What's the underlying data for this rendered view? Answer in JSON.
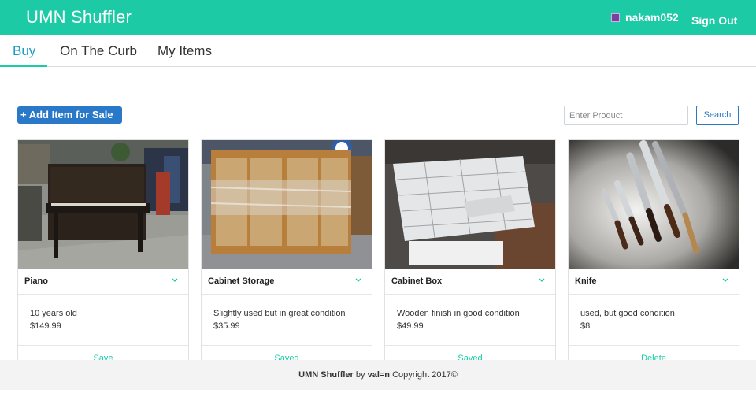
{
  "app": {
    "brand": "UMN Shuffler"
  },
  "header": {
    "username": "nakam052",
    "sign_out": "Sign Out"
  },
  "tabs": [
    {
      "label": "Buy",
      "active": true
    },
    {
      "label": "On The Curb",
      "active": false
    },
    {
      "label": "My Items",
      "active": false
    }
  ],
  "toolbar": {
    "add_label": "+ Add Item for Sale",
    "search_placeholder": "Enter Product",
    "search_value": "",
    "search_button": "Search"
  },
  "items": [
    {
      "title": "Piano",
      "description": "10 years old",
      "price": "$149.99",
      "action": "Save",
      "image": "piano-photo"
    },
    {
      "title": "Cabinet Storage",
      "description": "Slightly used but in great condition",
      "price": "$35.99",
      "action": "Saved",
      "image": "cabinet-storage-photo"
    },
    {
      "title": "Cabinet Box",
      "description": "Wooden finish in good condition",
      "price": "$49.99",
      "action": "Saved",
      "image": "cabinet-box-photo"
    },
    {
      "title": "Knife",
      "description": "used, but good condition",
      "price": "$8",
      "action": "Delete",
      "image": "knife-photo"
    }
  ],
  "footer": {
    "brand": "UMN Shuffler",
    "by": "by",
    "author": "val=n",
    "copyright": "Copyright 2017©"
  },
  "colors": {
    "primary": "#1ccba6",
    "button": "#2a79c9",
    "active_tab": "#1a9bc7"
  }
}
